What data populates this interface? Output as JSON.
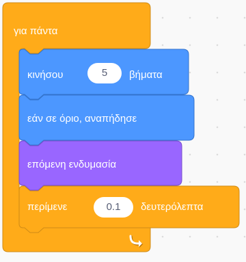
{
  "forever_block": {
    "label": "για πάντα",
    "color": "#ffab19",
    "border_color": "#cf8b17",
    "loop_icon": "loop-arrow-icon"
  },
  "motion_block": {
    "label_before": "κινήσου",
    "steps_value": "5",
    "label_after": "βήματα",
    "color": "#4c97ff",
    "border_color": "#3373cc"
  },
  "bounce_block": {
    "label": "εάν σε όριο, αναπήδησε",
    "color": "#4c97ff",
    "border_color": "#3373cc"
  },
  "costume_block": {
    "label": "επόμενη ενδυμασία",
    "color": "#9966ff",
    "border_color": "#774dcb"
  },
  "wait_block": {
    "label_before": "περίμενε",
    "seconds_value": "0.1",
    "label_after": "δευτερόλεπτα",
    "color": "#ffab19",
    "border_color": "#cf8b17"
  }
}
